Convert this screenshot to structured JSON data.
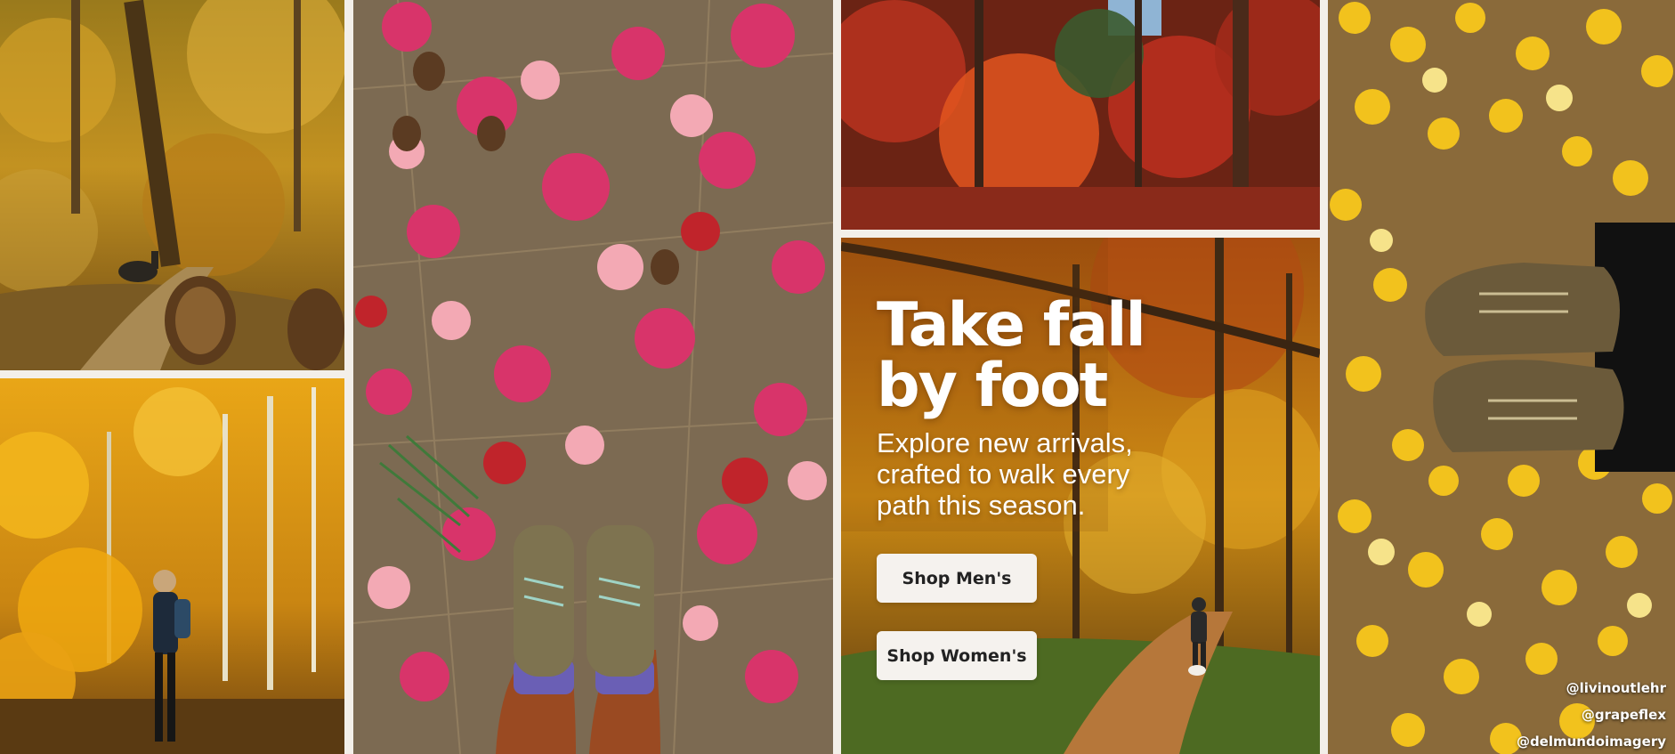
{
  "promo": {
    "headline_line1": "Take fall",
    "headline_line2": "by foot",
    "subhead": "Explore new arrivals, crafted to walk every path this season.",
    "cta_mens": "Shop Men's",
    "cta_womens": "Shop Women's"
  },
  "photo_credits": [
    "@livinoutlehr",
    "@grapeflex",
    "@delmundoimagery"
  ],
  "tiles": [
    {
      "id": "forest-dog",
      "icon": "autumn-forest-trail-photo"
    },
    {
      "id": "aspen-hiker",
      "icon": "yellow-aspen-hiker-photo"
    },
    {
      "id": "maple-boots",
      "icon": "maple-leaves-hiking-boots-photo"
    },
    {
      "id": "red-forest",
      "icon": "red-orange-forest-photo"
    },
    {
      "id": "promo-bg",
      "icon": "autumn-trail-walker-dog-photo"
    },
    {
      "id": "aspen-shoes",
      "icon": "aspen-leaves-hiking-shoes-photo"
    }
  ],
  "colors": {
    "background": "#f3efe9",
    "button_bg": "#f5f2ee",
    "button_text": "#222222",
    "headline_text": "#ffffff",
    "autumn_gold": "#d99a16",
    "maple_pink": "#d8346a",
    "maple_red": "#c0242b"
  }
}
